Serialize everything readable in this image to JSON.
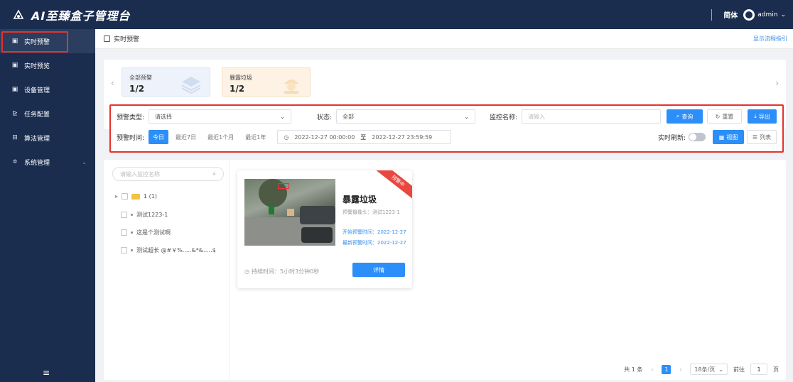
{
  "app": {
    "title": "AI至臻盒子管理台"
  },
  "header": {
    "language": "简体",
    "user": "admin"
  },
  "sidebar": {
    "items": [
      {
        "label": "实时预警",
        "icon": "monitor-icon"
      },
      {
        "label": "实时预览",
        "icon": "preview-icon"
      },
      {
        "label": "设备管理",
        "icon": "device-icon"
      },
      {
        "label": "任务配置",
        "icon": "task-icon"
      },
      {
        "label": "算法管理",
        "icon": "algorithm-icon"
      },
      {
        "label": "系统管理",
        "icon": "settings-icon"
      }
    ]
  },
  "breadcrumb": {
    "current": "实时预警",
    "flow_link": "显示流程指引"
  },
  "stat_cards": [
    {
      "label": "全部预警",
      "count": "1/2"
    },
    {
      "label": "暴露垃圾",
      "count": "1/2"
    }
  ],
  "filters": {
    "alert_type_label": "预警类型:",
    "alert_type_value": "请选择",
    "status_label": "状态:",
    "status_value": "全部",
    "monitor_name_label": "监控名称:",
    "monitor_name_placeholder": "请输入",
    "query_label": "查询",
    "reset_label": "重置",
    "export_label": "导出",
    "time_label": "预警时间:",
    "time_options": [
      "今日",
      "最近7日",
      "最近1个月",
      "最近1年"
    ],
    "date_start": "2022-12-27 00:00:00",
    "date_sep": "至",
    "date_end": "2022-12-27 23:59:59",
    "realtime_label": "实时刷新:",
    "view_grid_label": "视图",
    "view_list_label": "列表"
  },
  "tree": {
    "search_placeholder": "请输入监控名称",
    "nodes": [
      "1 (1)",
      "测试1223-1",
      "这是个测试啊",
      "测试超长 @#￥%.....&*&.....$"
    ]
  },
  "alarm_card": {
    "badge": "预警中",
    "title": "暴露垃圾",
    "camera": "预警摄像头：测试1223-1",
    "start_time": "开始预警时间：2022-12-27",
    "latest_time": "最新预警时间：2022-12-27",
    "duration": "持续时间：5小时3分钟0秒",
    "detail_label": "详情"
  },
  "pagination": {
    "total": "共 1 条",
    "current_page": "1",
    "page_size": "18条/页",
    "goto_label": "前往",
    "goto_value": "1",
    "page_unit": "页"
  }
}
